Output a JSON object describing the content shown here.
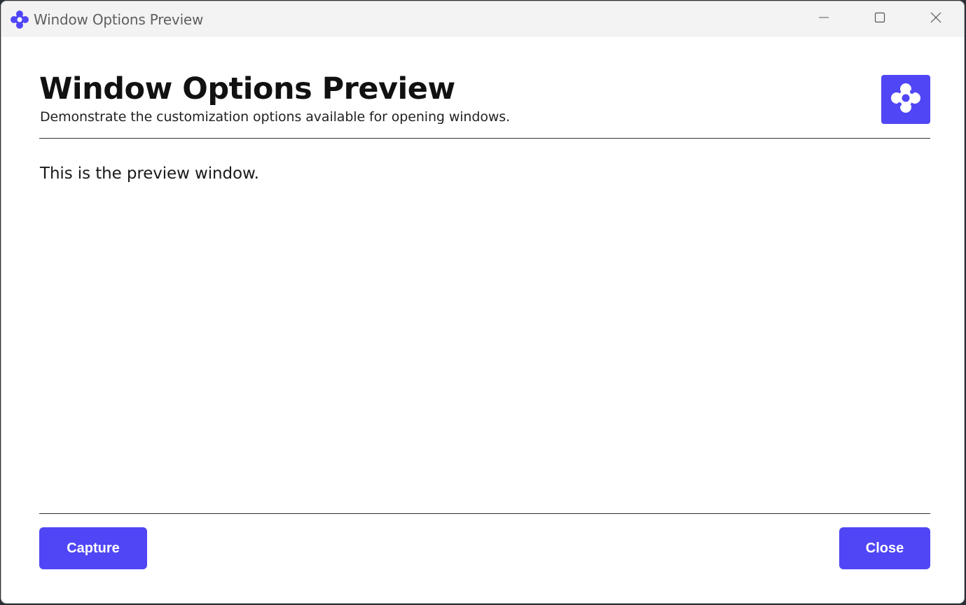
{
  "titlebar": {
    "title": "Window Options Preview",
    "icon": "app-logo-icon",
    "controls": [
      "minimize-icon",
      "maximize-icon",
      "close-icon"
    ]
  },
  "header": {
    "title": "Window Options Preview",
    "subtitle": "Demonstrate the customization options available for opening windows.",
    "logo_icon": "app-logo-icon"
  },
  "main": {
    "text": "This is the preview window."
  },
  "footer": {
    "capture_label": "Capture",
    "close_label": "Close"
  },
  "colors": {
    "accent": "#5046f5",
    "titlebar_bg": "#f3f3f3",
    "text": "#111111"
  }
}
